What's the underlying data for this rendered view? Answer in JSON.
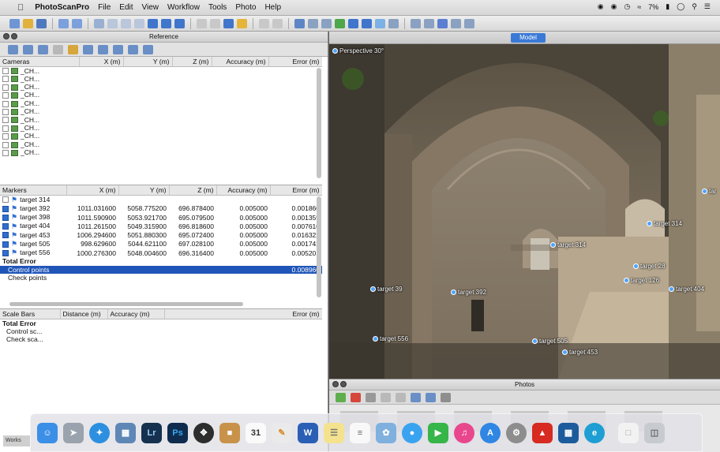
{
  "menubar": {
    "app": "PhotoScanPro",
    "items": [
      "File",
      "Edit",
      "View",
      "Workflow",
      "Tools",
      "Photo",
      "Help"
    ],
    "battery": "7%"
  },
  "reference_panel": {
    "title": "Reference"
  },
  "cameras": {
    "headers": [
      "Cameras",
      "X (m)",
      "Y (m)",
      "Z (m)",
      "Accuracy (m)",
      "Error (m)"
    ],
    "rows": [
      "_CH...",
      "_CH...",
      "_CH...",
      "_CH...",
      "_CH...",
      "_CH...",
      "_CH...",
      "_CH...",
      "_CH...",
      "_CH...",
      "_CH..."
    ]
  },
  "markers": {
    "headers": [
      "Markers",
      "X (m)",
      "Y (m)",
      "Z (m)",
      "Accuracy (m)",
      "Error (m)"
    ],
    "rows": [
      {
        "name": "target 314",
        "checked": false,
        "x": "",
        "y": "",
        "z": "",
        "acc": "",
        "err": ""
      },
      {
        "name": "target 392",
        "checked": true,
        "x": "1011.031600",
        "y": "5058.775200",
        "z": "696.878400",
        "acc": "0.005000",
        "err": "0.001860"
      },
      {
        "name": "target 398",
        "checked": true,
        "x": "1011.590900",
        "y": "5053.921700",
        "z": "695.079500",
        "acc": "0.005000",
        "err": "0.001359"
      },
      {
        "name": "target 404",
        "checked": true,
        "x": "1011.261500",
        "y": "5049.315900",
        "z": "696.818600",
        "acc": "0.005000",
        "err": "0.007610"
      },
      {
        "name": "target 453",
        "checked": true,
        "x": "1006.294600",
        "y": "5051.880300",
        "z": "695.072400",
        "acc": "0.005000",
        "err": "0.016322"
      },
      {
        "name": "target 505",
        "checked": true,
        "x": "998.629600",
        "y": "5044.621100",
        "z": "697.028100",
        "acc": "0.005000",
        "err": "0.001742"
      },
      {
        "name": "target 556",
        "checked": true,
        "x": "1000.276300",
        "y": "5048.004600",
        "z": "696.316400",
        "acc": "0.005000",
        "err": "0.005201"
      }
    ],
    "total_error": "Total Error",
    "control_points": "Control points",
    "control_value": "0.008960",
    "check_points": "Check points"
  },
  "scalebars": {
    "headers": [
      "Scale Bars",
      "Distance (m)",
      "Accuracy (m)",
      "Error (m)"
    ],
    "total_error": "Total Error",
    "control": "Control sc...",
    "check": "Check sca..."
  },
  "model": {
    "tab": "Model",
    "perspective": "Perspective 30°",
    "markers": [
      "target 314",
      "target 39",
      "target 392",
      "target 28",
      "target 126",
      "target 404",
      "target 556",
      "target 505",
      "target 453",
      "tar"
    ]
  },
  "photos": {
    "title": "Photos"
  },
  "bottom_tab": "Works",
  "dock": [
    "Finder",
    "Launchpad",
    "Safari",
    "Preview",
    "Lr",
    "Ps",
    "Compass",
    "Contacts",
    "31",
    "Pages",
    "W",
    "Notes",
    "Reminders",
    "Photos",
    "Messages",
    "FaceTime",
    "iTunes",
    "App Store",
    "Preferences",
    "Acrobat",
    "Media",
    "e",
    "Document",
    "Trash"
  ]
}
